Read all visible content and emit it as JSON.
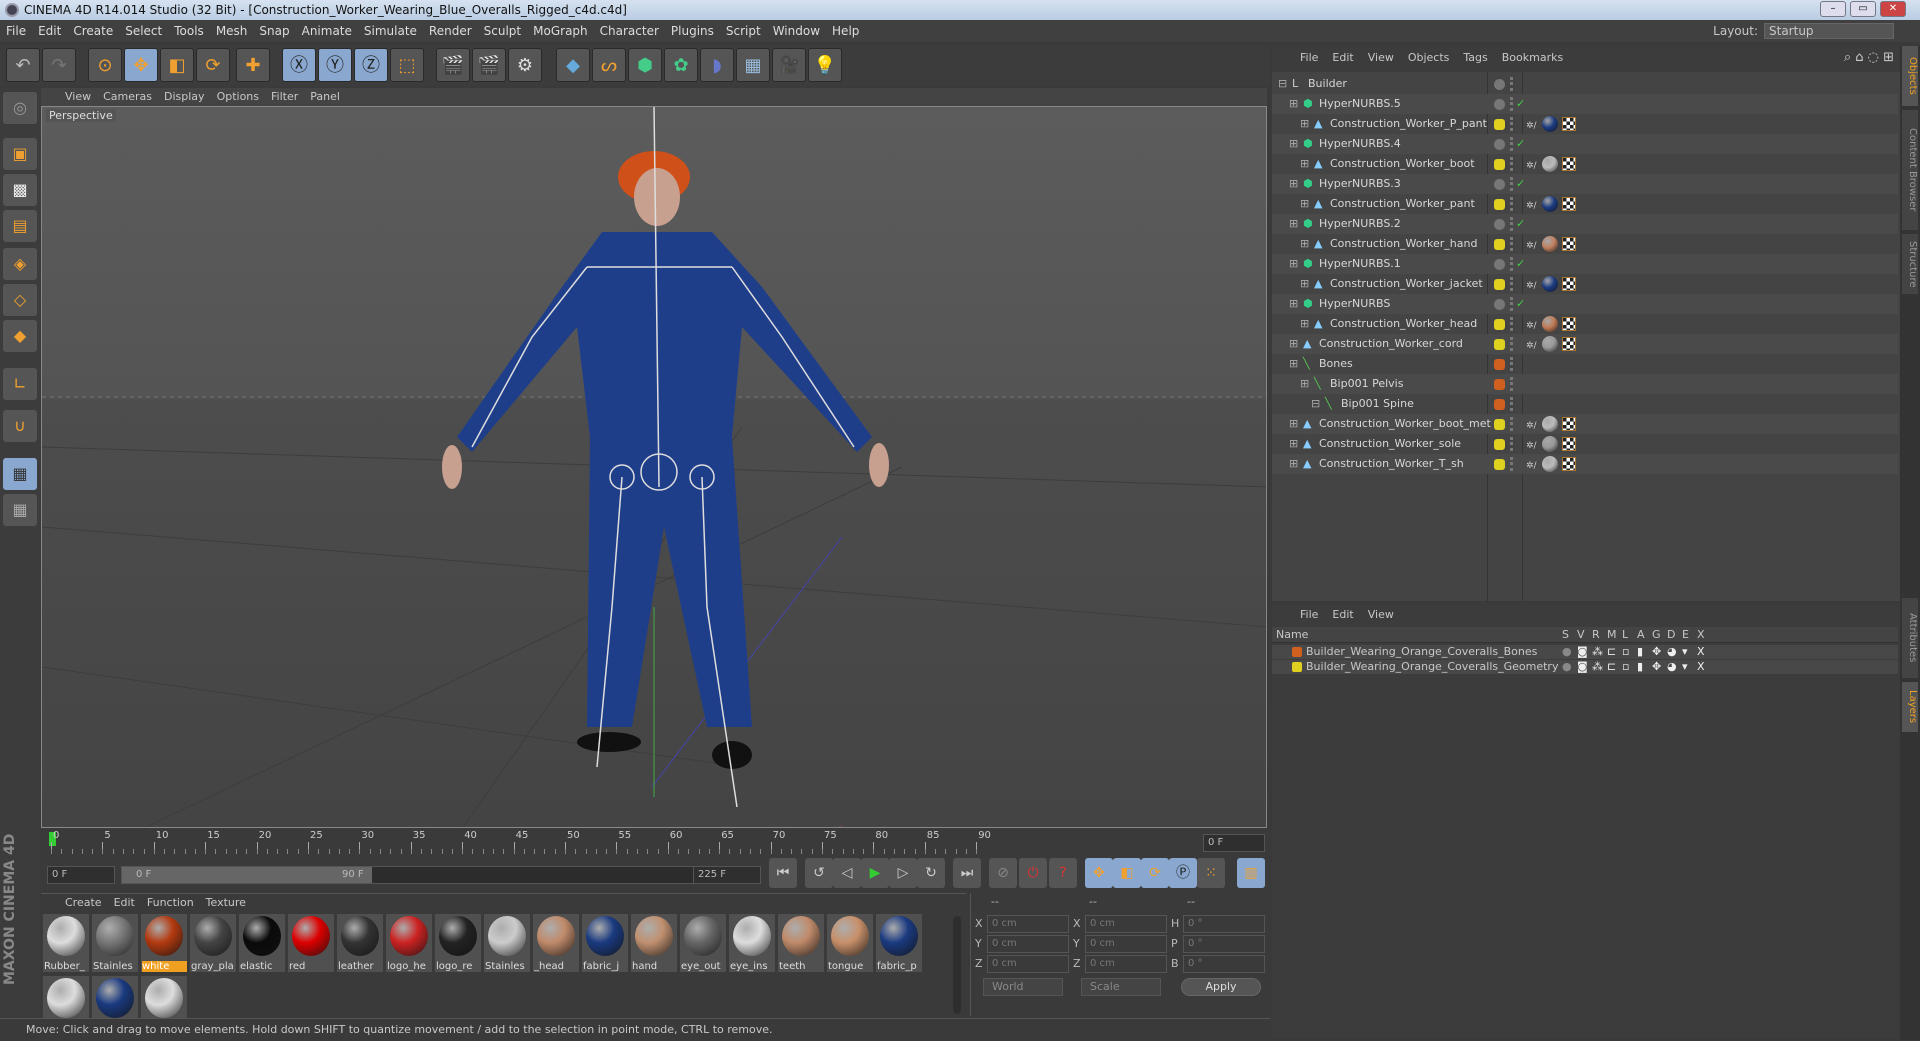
{
  "title": "CINEMA 4D R14.014 Studio (32 Bit) - [Construction_Worker_Wearing_Blue_Overalls_Rigged_c4d.c4d]",
  "menu": [
    "File",
    "Edit",
    "Create",
    "Select",
    "Tools",
    "Mesh",
    "Snap",
    "Animate",
    "Simulate",
    "Render",
    "Sculpt",
    "MoGraph",
    "Character",
    "Plugins",
    "Script",
    "Window",
    "Help"
  ],
  "layout": {
    "label": "Layout:",
    "value": "Startup"
  },
  "viewport": {
    "menu": [
      "View",
      "Cameras",
      "Display",
      "Options",
      "Filter",
      "Panel"
    ],
    "label": "Perspective"
  },
  "timeline": {
    "ticks": [
      "0",
      "5",
      "10",
      "15",
      "20",
      "25",
      "30",
      "35",
      "40",
      "45",
      "50",
      "55",
      "60",
      "65",
      "70",
      "75",
      "80",
      "85",
      "90"
    ],
    "current": "0 F",
    "start": "0 F",
    "range_start": "0 F",
    "range_end": "90 F",
    "end": "225 F"
  },
  "materials": {
    "menu": [
      "Create",
      "Edit",
      "Function",
      "Texture"
    ],
    "items": [
      {
        "name": "Rubber_",
        "color": "#ddd"
      },
      {
        "name": "Stainles",
        "color": "#777"
      },
      {
        "name": "white",
        "color": "#b33a10",
        "selected": true
      },
      {
        "name": "gray_pla",
        "color": "#444"
      },
      {
        "name": "elastic",
        "color": "#0a0a0a"
      },
      {
        "name": "red",
        "color": "#d00"
      },
      {
        "name": "leather",
        "color": "#333"
      },
      {
        "name": "logo_he",
        "color": "#c22"
      },
      {
        "name": "logo_re",
        "color": "#222"
      },
      {
        "name": "Stainles",
        "color": "#ccc"
      },
      {
        "name": "_head",
        "color": "#c08a6a"
      },
      {
        "name": "fabric_j",
        "color": "#1a3a80"
      },
      {
        "name": "hand",
        "color": "#c09070"
      },
      {
        "name": "eye_out",
        "color": "#666"
      },
      {
        "name": "eye_ins",
        "color": "#ddd"
      },
      {
        "name": "teeth",
        "color": "#c08a6a"
      },
      {
        "name": "tongue",
        "color": "#c8906a"
      },
      {
        "name": "fabric_p",
        "color": "#1a3a80"
      },
      {
        "name": "",
        "color": "#ddd"
      },
      {
        "name": "",
        "color": "#1a3a80"
      },
      {
        "name": "",
        "color": "#ddd"
      }
    ]
  },
  "coords": {
    "headers": [
      "--",
      "--",
      "--"
    ],
    "rows": [
      [
        "X",
        "0 cm",
        "X",
        "0 cm",
        "H",
        "0 °"
      ],
      [
        "Y",
        "0 cm",
        "Y",
        "0 cm",
        "P",
        "0 °"
      ],
      [
        "Z",
        "0 cm",
        "Z",
        "0 cm",
        "B",
        "0 °"
      ]
    ],
    "mode": "World",
    "scale": "Scale",
    "apply": "Apply"
  },
  "status": "Move: Click and drag to move elements. Hold down SHIFT to quantize movement / add to the selection in point mode, CTRL to remove.",
  "brand": "MAXON CINEMA 4D",
  "objects": {
    "menu": [
      "File",
      "Edit",
      "View",
      "Objects",
      "Tags",
      "Bookmarks"
    ],
    "items": [
      {
        "name": "Builder",
        "depth": 0,
        "type": "null",
        "dot": "#777"
      },
      {
        "name": "HyperNURBS.5",
        "depth": 1,
        "type": "nurbs",
        "dot": "#777",
        "check": true
      },
      {
        "name": "Construction_Worker_P_pant",
        "depth": 2,
        "type": "mesh",
        "dot": "#e0d020",
        "mat": "#1a3a80"
      },
      {
        "name": "HyperNURBS.4",
        "depth": 1,
        "type": "nurbs",
        "dot": "#777",
        "check": true
      },
      {
        "name": "Construction_Worker_boot",
        "depth": 2,
        "type": "mesh",
        "dot": "#e0d020",
        "mat": "#bbb"
      },
      {
        "name": "HyperNURBS.3",
        "depth": 1,
        "type": "nurbs",
        "dot": "#777",
        "check": true
      },
      {
        "name": "Construction_Worker_pant",
        "depth": 2,
        "type": "mesh",
        "dot": "#e0d020",
        "mat": "#1a3a80"
      },
      {
        "name": "HyperNURBS.2",
        "depth": 1,
        "type": "nurbs",
        "dot": "#777",
        "check": true
      },
      {
        "name": "Construction_Worker_hand",
        "depth": 2,
        "type": "mesh",
        "dot": "#e0d020",
        "mat": "#c08060"
      },
      {
        "name": "HyperNURBS.1",
        "depth": 1,
        "type": "nurbs",
        "dot": "#777",
        "check": true
      },
      {
        "name": "Construction_Worker_jacket",
        "depth": 2,
        "type": "mesh",
        "dot": "#e0d020",
        "mat": "#1a3a80"
      },
      {
        "name": "HyperNURBS",
        "depth": 1,
        "type": "nurbs",
        "dot": "#777",
        "check": true
      },
      {
        "name": "Construction_Worker_head",
        "depth": 2,
        "type": "mesh",
        "dot": "#e0d020",
        "mat": "#c07a55"
      },
      {
        "name": "Construction_Worker_cord",
        "depth": 1,
        "type": "mesh",
        "dot": "#e0d020",
        "mat": "#999"
      },
      {
        "name": "Bones",
        "depth": 1,
        "type": "bone",
        "dot": "#d06020"
      },
      {
        "name": "Bip001 Pelvis",
        "depth": 2,
        "type": "bone",
        "dot": "#d06020"
      },
      {
        "name": "Bip001 Spine",
        "depth": 3,
        "type": "bone",
        "dot": "#d06020"
      },
      {
        "name": "Construction_Worker_boot_met",
        "depth": 1,
        "type": "mesh",
        "dot": "#e0d020",
        "mat": "#bbb"
      },
      {
        "name": "Construction_Worker_sole",
        "depth": 1,
        "type": "mesh",
        "dot": "#e0d020",
        "mat": "#999"
      },
      {
        "name": "Construction_Worker_T_sh",
        "depth": 1,
        "type": "mesh",
        "dot": "#e0d020",
        "mat": "#bbb"
      }
    ]
  },
  "layers": {
    "menu": [
      "File",
      "Edit",
      "View"
    ],
    "columns": [
      "Name",
      "S",
      "V",
      "R",
      "M",
      "L",
      "A",
      "G",
      "D",
      "E",
      "X"
    ],
    "items": [
      {
        "name": "Builder_Wearing_Orange_Coveralls_Bones",
        "color": "#d06020"
      },
      {
        "name": "Builder_Wearing_Orange_Coveralls_Geometry",
        "color": "#e0d020"
      }
    ]
  },
  "sidetabs": [
    "Objects",
    "Content Browser",
    "Structure",
    "Attributes",
    "Layers"
  ]
}
